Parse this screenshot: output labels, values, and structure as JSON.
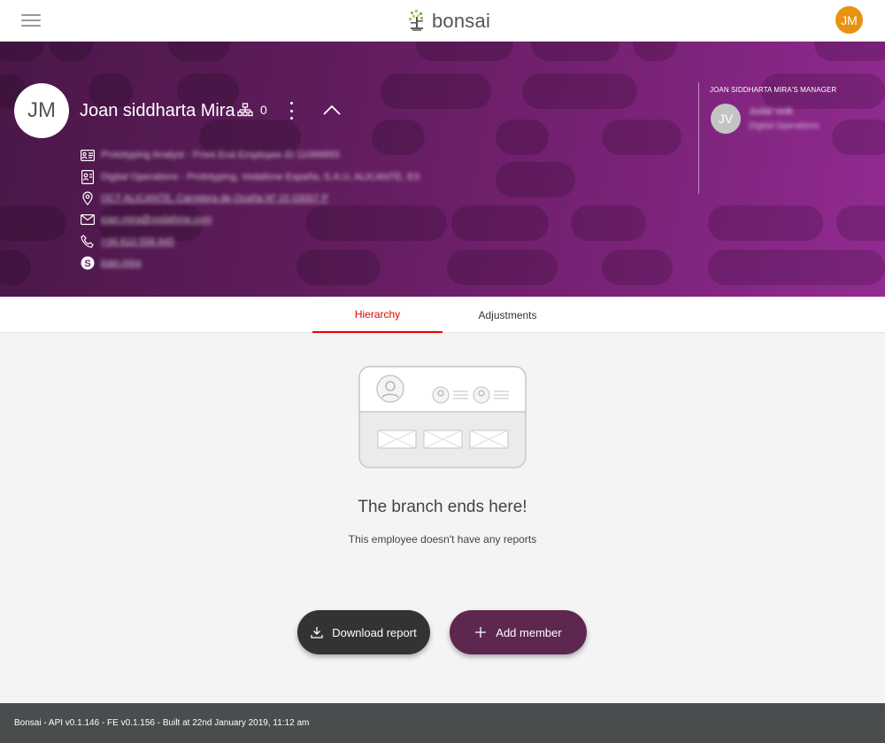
{
  "header": {
    "menu_icon": "hamburger-icon",
    "logo_text": "bonsai",
    "user_initials": "JM"
  },
  "profile": {
    "initials": "JM",
    "name": "Joan siddharta Mira",
    "reports_count": "0",
    "details": [
      {
        "icon": "id-card-icon",
        "text": "Prototyping Analyst - Front End Employee ID 11066893",
        "link": false
      },
      {
        "icon": "badge-icon",
        "text": "Digital Operations - Prototyping, Vodafone España, S.A.U, ALICANTE, ES",
        "link": false
      },
      {
        "icon": "location-icon",
        "text": "OCT ALICANTE, Carretera de Ocaña Nº 15 03007 P",
        "link": true
      },
      {
        "icon": "mail-icon",
        "text": "joan.mira@vodafone.com",
        "link": true
      },
      {
        "icon": "phone-icon",
        "text": "+34 610 558 845",
        "link": true
      },
      {
        "icon": "skype-icon",
        "text": "joan.mira",
        "link": true
      }
    ]
  },
  "manager": {
    "label": "JOAN SIDDHARTA MIRA'S MANAGER",
    "initials": "JV",
    "name": "Judal Volk",
    "department": "Digital Operations"
  },
  "tabs": [
    {
      "label": "Hierarchy",
      "active": true
    },
    {
      "label": "Adjustments",
      "active": false
    }
  ],
  "empty_state": {
    "title": "The branch ends here!",
    "subtitle": "This employee doesn't have any reports"
  },
  "actions": {
    "download_label": "Download report",
    "add_label": "Add member"
  },
  "footer": {
    "text": "Bonsai - API v0.1.146 - FE v0.1.156 - Built at 22nd January 2019, 11:12 am"
  },
  "colors": {
    "accent_red": "#e60000",
    "avatar_orange": "#e8920f",
    "hero_purple": "#7a2277",
    "add_button": "#5e2750",
    "download_button": "#333333",
    "footer_bg": "#4a4d4e"
  }
}
